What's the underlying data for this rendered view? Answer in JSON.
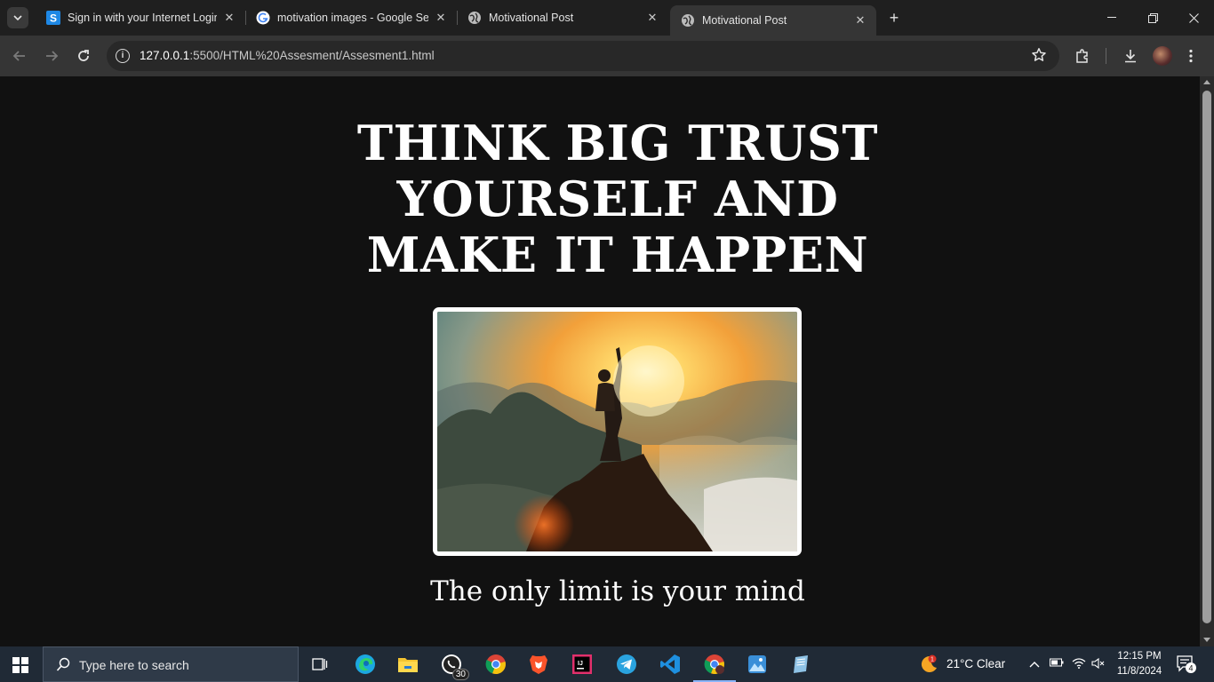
{
  "browser": {
    "tabs": [
      {
        "title": "Sign in with your Internet Login",
        "favicon": "s-logo-icon",
        "active": false
      },
      {
        "title": "motivation images - Google Sea",
        "favicon": "google-icon",
        "active": false
      },
      {
        "title": "Motivational Post",
        "favicon": "globe-icon",
        "active": false
      },
      {
        "title": "Motivational Post",
        "favicon": "globe-icon",
        "active": true
      }
    ],
    "url_host": "127.0.0.1",
    "url_path": ":5500/HTML%20Assesment/Assesment1.html"
  },
  "page": {
    "headline": "THINK BIG TRUST YOURSELF AND MAKE IT HAPPEN",
    "image_alt": "person with raised fist on a mountain peak at sunrise",
    "caption": "The only limit is your mind"
  },
  "taskbar": {
    "search_placeholder": "Type here to search",
    "whatsapp_badge": "30",
    "weather_badge": "1",
    "weather": "21°C  Clear",
    "time": "12:15 PM",
    "date": "11/8/2024",
    "notification_count": "4"
  },
  "colors": {
    "page_bg": "#111111",
    "tabstrip_bg": "#1f1f1f",
    "toolbar_bg": "#353535",
    "taskbar_bg": "#202a36"
  }
}
